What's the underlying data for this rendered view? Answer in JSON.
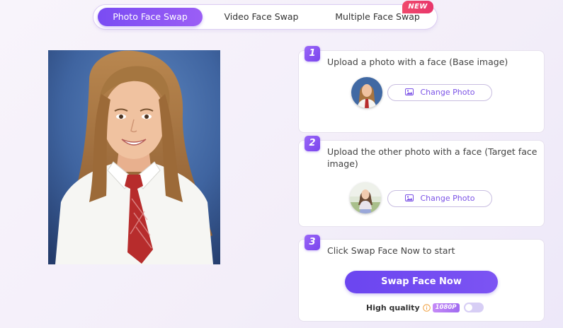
{
  "tabs": [
    {
      "label": "Photo Face Swap",
      "active": true
    },
    {
      "label": "Video Face Swap",
      "active": false
    },
    {
      "label": "Multiple Face Swap",
      "active": false
    }
  ],
  "new_badge": "NEW",
  "steps": [
    {
      "number": "1",
      "text": "Upload a photo with a face (Base image)",
      "button": "Change Photo"
    },
    {
      "number": "2",
      "text": "Upload the other photo with a face (Target face image)",
      "button": "Change Photo"
    },
    {
      "number": "3",
      "text": "Click Swap Face Now to start",
      "button": "Swap Face Now"
    }
  ],
  "quality": {
    "label": "High quality",
    "badge": "1080P",
    "enabled": false
  },
  "icons": {
    "change_photo": "image-icon",
    "quality_info": "info-icon"
  },
  "colors": {
    "accent": "#7a4cf3",
    "new_badge": "#e8366b",
    "info": "#f0a040"
  }
}
